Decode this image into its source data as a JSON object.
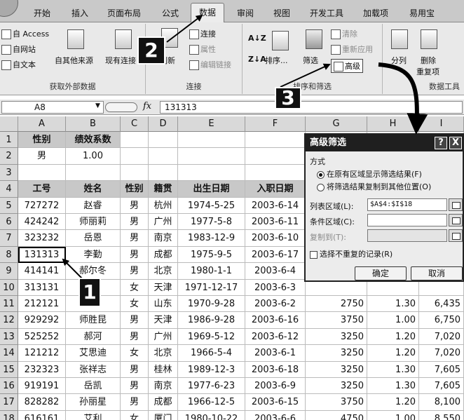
{
  "ribbon_tabs": [
    "开始",
    "插入",
    "页面布局",
    "公式",
    "数据",
    "审阅",
    "视图",
    "开发工具",
    "加载项",
    "易用宝"
  ],
  "active_tab": "数据",
  "external_group": {
    "label": "获取外部数据",
    "access": "自 Access",
    "web": "自网站",
    "text": "自文本",
    "other": "自其他来源",
    "existing": "现有连接"
  },
  "connections_group": {
    "label": "连接",
    "refresh": "刷新",
    "connections": "连接",
    "properties": "属性",
    "edit_links": "编辑链接"
  },
  "sort_filter_group": {
    "label": "排序和筛选",
    "sort": "排序...",
    "filter": "筛选",
    "clear": "清除",
    "reapply": "重新应用",
    "advanced": "高级"
  },
  "data_tools_group": {
    "label": "数据工具",
    "split": "分列",
    "remove_dup_1": "删除",
    "remove_dup_2": "重复项"
  },
  "formula_bar": {
    "name_box": "A8",
    "fx": "fx",
    "value": "131313"
  },
  "columns": [
    "A",
    "B",
    "C",
    "D",
    "E",
    "F",
    "G",
    "H",
    "I"
  ],
  "criteria": {
    "headers": [
      "性别",
      "绩效系数"
    ],
    "values": [
      "男",
      "1.00"
    ]
  },
  "table": {
    "headers": [
      "工号",
      "姓名",
      "性别",
      "籍贯",
      "出生日期",
      "入职日期"
    ],
    "rows": [
      [
        "727272",
        "赵睿",
        "男",
        "杭州",
        "1974-5-25",
        "2003-6-14",
        "",
        "",
        ""
      ],
      [
        "424242",
        "师丽莉",
        "男",
        "广州",
        "1977-5-8",
        "2003-6-11",
        "",
        "",
        ""
      ],
      [
        "323232",
        "岳恩",
        "男",
        "南京",
        "1983-12-9",
        "2003-6-10",
        "",
        "",
        ""
      ],
      [
        "131313",
        "李勤",
        "男",
        "成都",
        "1975-9-5",
        "2003-6-17",
        "",
        "",
        ""
      ],
      [
        "414141",
        "郝尔冬",
        "男",
        "北京",
        "1980-1-1",
        "2003-6-4",
        "",
        "",
        ""
      ],
      [
        "313131",
        "",
        "女",
        "天津",
        "1971-12-17",
        "2003-6-3",
        "",
        "",
        ""
      ],
      [
        "212121",
        "",
        "女",
        "山东",
        "1970-9-28",
        "2003-6-2",
        "2750",
        "1.30",
        "6,435"
      ],
      [
        "929292",
        "师胜昆",
        "男",
        "天津",
        "1986-9-28",
        "2003-6-16",
        "3750",
        "1.00",
        "6,750"
      ],
      [
        "525252",
        "郝河",
        "男",
        "广州",
        "1969-5-12",
        "2003-6-12",
        "3250",
        "1.20",
        "7,020"
      ],
      [
        "121212",
        "艾思迪",
        "女",
        "北京",
        "1966-5-4",
        "2003-6-1",
        "3250",
        "1.20",
        "7,020"
      ],
      [
        "232323",
        "张祥志",
        "男",
        "桂林",
        "1989-12-3",
        "2003-6-18",
        "3250",
        "1.30",
        "7,605"
      ],
      [
        "919191",
        "岳凯",
        "男",
        "南京",
        "1977-6-23",
        "2003-6-9",
        "3250",
        "1.30",
        "7,605"
      ],
      [
        "828282",
        "孙丽星",
        "男",
        "成都",
        "1966-12-5",
        "2003-6-15",
        "3750",
        "1.20",
        "8,100"
      ],
      [
        "616161",
        "艾利",
        "女",
        "厦门",
        "1980-10-22",
        "2003-6-6",
        "4750",
        "1.00",
        "8,550"
      ]
    ]
  },
  "dialog": {
    "title": "高级筛选",
    "help": "?",
    "close": "X",
    "mode_label": "方式",
    "opt_inplace": "在原有区域显示筛选结果(F)",
    "opt_copy": "将筛选结果复制到其他位置(O)",
    "list_label": "列表区域(L):",
    "list_value": "$A$4:$I$18",
    "criteria_label": "条件区域(C):",
    "criteria_value": "",
    "copyto_label": "复制到(T):",
    "copyto_value": "",
    "unique_label": "选择不重复的记录(R)",
    "ok": "确定",
    "cancel": "取消"
  },
  "annotations": [
    "1",
    "2",
    "3"
  ]
}
